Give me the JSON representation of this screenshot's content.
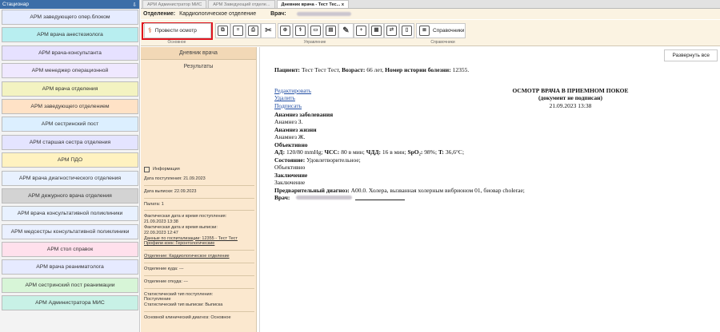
{
  "left": {
    "header": "Стационар",
    "header_pin": "⇩",
    "items": [
      {
        "label": "АРМ заведующего опер.блоком",
        "color": "#e6ecff"
      },
      {
        "label": "АРМ врача анестезиолога",
        "color": "#b8eef0"
      },
      {
        "label": "АРМ врача-консультанта",
        "color": "#e6e1ff"
      },
      {
        "label": "АРМ менеджер операционной",
        "color": "#efe8ff"
      },
      {
        "label": "АРМ врача отделения",
        "color": "#f3f3c1"
      },
      {
        "label": "АРМ заведующего отделением",
        "color": "#ffe2c6"
      },
      {
        "label": "АРМ сестринский пост",
        "color": "#dcefff"
      },
      {
        "label": "АРМ старшая сестра отделения",
        "color": "#e4e4ff"
      },
      {
        "label": "АРМ ПДО",
        "color": "#fff2c0"
      },
      {
        "label": "АРМ врача диагностического отделения",
        "color": "#e8f1ff"
      },
      {
        "label": "АРМ дежурного врача отделения",
        "color": "#d3d3d3"
      },
      {
        "label": "АРМ врача консультативной поликлиники",
        "color": "#e8f1ff"
      },
      {
        "label": "АРМ медсестры консультативной поликлиники",
        "color": "#eaf0ff"
      },
      {
        "label": "АРМ стол справок",
        "color": "#ffe0ec"
      },
      {
        "label": "АРМ врача реаниматолога",
        "color": "#e6eaff"
      },
      {
        "label": "АРМ сестринский пост реанимации",
        "color": "#d7f5d7"
      },
      {
        "label": "АРМ Администратора МИС",
        "color": "#c8f1e6"
      }
    ]
  },
  "tabs": [
    "АРМ Администратор МИС",
    "АРМ Заведующий отделе...",
    "Дневник врача - Тест Тес... x"
  ],
  "infobar": {
    "dept_label": "Отделение:",
    "dept_value": "Кардиологическое отделение",
    "doctor_label": "Врач:"
  },
  "toolbar": {
    "exam_button": "Провести осмотр",
    "handbooks_button": "Справочники",
    "group_main": "Основное",
    "group_manage": "Управление",
    "group_handbooks": "Справочники",
    "icons": [
      "copy-icon",
      "document-icon",
      "print-icon",
      "scissors-icon",
      "paste-icon",
      "stethoscope-icon",
      "tablet-icon",
      "clipboard-icon",
      "edit-icon",
      "add-document-icon",
      "calendar-icon",
      "transfer-icon",
      "file-icon",
      "stack-icon"
    ]
  },
  "leftpanel": {
    "tab_diary": "Дневник врача",
    "tab_results": "Результаты",
    "info_title": "Информация",
    "admission": "Дата поступления: 21.09.2023",
    "discharge": "Дата выписки: 22.09.2023",
    "ward": "Палата: 1",
    "fact_in_label": "Фактическая дата и время поступления:",
    "fact_in": "21.09.2023 13:38",
    "fact_out_label": "Фактическая дата и время выписки:",
    "fact_out": "22.09.2023 12:47",
    "hosp_data": "Данные по госпитализации: 12355 - Тест Тест",
    "profile": "Профили коек: Геронтологические",
    "department": "Отделение: Кардиологическое отделение",
    "dept_where": "Отделение куда: ---",
    "dept_from": "Отделение откуда: ---",
    "stat_in_label": "Статистический тип поступления:",
    "stat_in": "Поступление",
    "stat_out": "Статистический тип выписки: Выписка",
    "main_diag": "Основной клинический диагноз: Основное"
  },
  "doc": {
    "expand": "Развернуть все",
    "patient_label": "Пациент:",
    "patient": "Тест Тест Тест,",
    "age_label": "Возраст:",
    "age": "66 лет,",
    "history_label": "Номер истории болезни:",
    "history": "12355.",
    "link_edit": "Редактировать",
    "link_delete": "Удалить",
    "link_sign": "Подписать",
    "title": "ОСМОТР ВРАЧА В ПРИЕМНОМ ПОКОЕ",
    "unsigned": "(документ не подписан)",
    "datetime": "21.09.2023 13:38",
    "anamnesis_disease_h": "Анамнез заболевания",
    "anamnesis_disease": "Анамнез З.",
    "anamnesis_life_h": "Анамнез жизни",
    "anamnesis_life": "Анамнез Ж.",
    "objective_h": "Объективно",
    "ad_label": "АД:",
    "ad_value": "120/80 mmHg;",
    "hr_label": "ЧСС:",
    "hr_value": "80 в мин;",
    "rr_label": "ЧДД:",
    "rr_value": "16 в мин;",
    "spo2_label": "SpO₂:",
    "spo2_value": "98%;",
    "t_label": "T:",
    "t_value": "36,6°C;",
    "state_label": "Состояние:",
    "state_value": "Удовлетворительное;",
    "objective_text": "Объективно",
    "conclusion_h": "Заключение",
    "conclusion": "Заключение",
    "prelim_label": "Предварительный диагноз:",
    "prelim_value": "A00.0. Холера, вызванная холерным вибрионом 01, биовар cholerae;",
    "doctor_label": "Врач:"
  }
}
